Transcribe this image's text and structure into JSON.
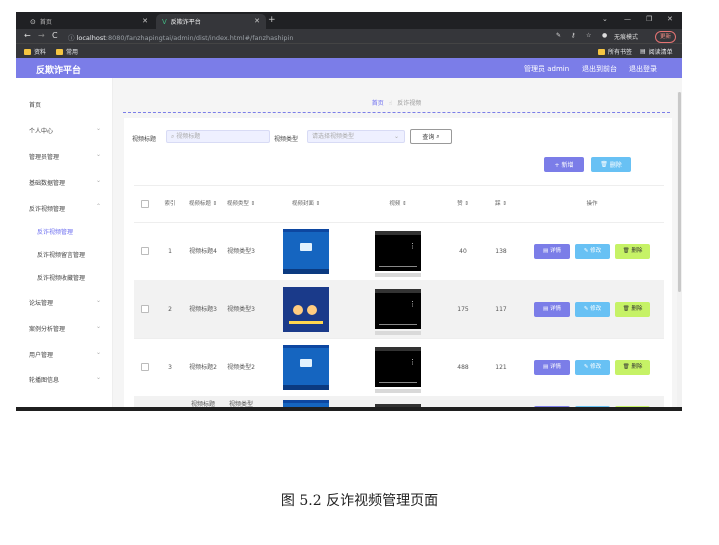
{
  "browser": {
    "tabs": [
      {
        "label": "首页",
        "icon": "globe-icon"
      },
      {
        "label": "反欺诈平台",
        "icon": "vue-icon"
      }
    ],
    "url_host": "localhost",
    "url_rest": ":8080/fanzhapingtai/admin/dist/index.html#/fanzhashipin",
    "incognito_label": "无痕模式",
    "update_label": "更新",
    "bookmarks": [
      "资料",
      "常用"
    ],
    "bookmarks_right": [
      "所有书签",
      "阅读清单"
    ]
  },
  "header": {
    "brand": "反欺诈平台",
    "links": [
      "管理员 admin",
      "退出到前台",
      "退出登录"
    ]
  },
  "sidebar": {
    "items": [
      "首页",
      "个人中心",
      "管理员管理",
      "基础数据管理",
      "反诈视频管理",
      "论坛管理",
      "案例分析管理",
      "用户管理",
      "轮播图信息"
    ],
    "subitems": [
      "反诈视频管理",
      "反诈视频留言管理",
      "反诈视频收藏管理"
    ]
  },
  "breadcrumb": {
    "home": "首页",
    "current": "反诈视频"
  },
  "search": {
    "title_label": "视频标题",
    "title_placeholder": "视频标题",
    "type_label": "视频类型",
    "type_placeholder": "请选择视频类型",
    "query_label": "查询"
  },
  "actions": {
    "add_label": "+ 新增",
    "delete_label": "删除"
  },
  "table": {
    "columns": [
      "索引",
      "视频标题",
      "视频类型",
      "视频封面",
      "视频",
      "赞",
      "踩",
      "操作"
    ],
    "rows": [
      {
        "index": "1",
        "title": "视频标题4",
        "type": "视频类型3",
        "likes": "40",
        "dislikes": "138"
      },
      {
        "index": "2",
        "title": "视频标题3",
        "type": "视频类型3",
        "likes": "175",
        "dislikes": "117"
      },
      {
        "index": "3",
        "title": "视频标题2",
        "type": "视频类型2",
        "likes": "488",
        "dislikes": "121"
      },
      {
        "index": "",
        "title": "视频标题",
        "type": "视频类型",
        "likes": "",
        "dislikes": ""
      }
    ],
    "row_actions": {
      "detail": "详情",
      "edit": "修改",
      "remove": "删除"
    }
  },
  "caption": "图 5.2 反诈视频管理页面"
}
